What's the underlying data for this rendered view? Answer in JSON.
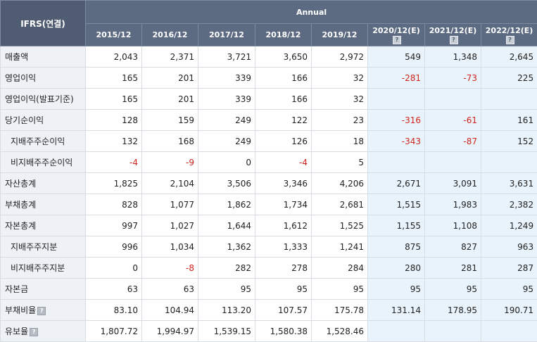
{
  "header": {
    "corner_label": "IFRS(연결)",
    "group_label": "Annual",
    "help_glyph": "?"
  },
  "columns": [
    {
      "label": "2015/12",
      "estimate": false
    },
    {
      "label": "2016/12",
      "estimate": false
    },
    {
      "label": "2017/12",
      "estimate": false
    },
    {
      "label": "2018/12",
      "estimate": false
    },
    {
      "label": "2019/12",
      "estimate": false
    },
    {
      "label": "2020/12(E)",
      "estimate": true
    },
    {
      "label": "2021/12(E)",
      "estimate": true
    },
    {
      "label": "2022/12(E)",
      "estimate": true
    }
  ],
  "rows": [
    {
      "label": "매출액",
      "sub": false,
      "help": false,
      "values": [
        "2,043",
        "2,371",
        "3,721",
        "3,650",
        "2,972",
        "549",
        "1,348",
        "2,645"
      ]
    },
    {
      "label": "영업이익",
      "sub": false,
      "help": false,
      "values": [
        "165",
        "201",
        "339",
        "166",
        "32",
        "-281",
        "-73",
        "225"
      ]
    },
    {
      "label": "영업이익(발표기준)",
      "sub": false,
      "help": false,
      "values": [
        "165",
        "201",
        "339",
        "166",
        "32",
        "",
        "",
        ""
      ]
    },
    {
      "label": "당기순이익",
      "sub": false,
      "help": false,
      "values": [
        "128",
        "159",
        "249",
        "122",
        "23",
        "-316",
        "-61",
        "161"
      ]
    },
    {
      "label": "지배주주순이익",
      "sub": true,
      "help": false,
      "values": [
        "132",
        "168",
        "249",
        "126",
        "18",
        "-343",
        "-87",
        "152"
      ]
    },
    {
      "label": "비지배주주순이익",
      "sub": true,
      "help": false,
      "values": [
        "-4",
        "-9",
        "0",
        "-4",
        "5",
        "",
        "",
        ""
      ]
    },
    {
      "label": "자산총계",
      "sub": false,
      "help": false,
      "values": [
        "1,825",
        "2,104",
        "3,506",
        "3,346",
        "4,206",
        "2,671",
        "3,091",
        "3,631"
      ]
    },
    {
      "label": "부채총계",
      "sub": false,
      "help": false,
      "values": [
        "828",
        "1,077",
        "1,862",
        "1,734",
        "2,681",
        "1,515",
        "1,983",
        "2,382"
      ]
    },
    {
      "label": "자본총계",
      "sub": false,
      "help": false,
      "values": [
        "997",
        "1,027",
        "1,644",
        "1,612",
        "1,525",
        "1,155",
        "1,108",
        "1,249"
      ]
    },
    {
      "label": "지배주주지분",
      "sub": true,
      "help": false,
      "values": [
        "996",
        "1,034",
        "1,362",
        "1,333",
        "1,241",
        "875",
        "827",
        "963"
      ]
    },
    {
      "label": "비지배주주지분",
      "sub": true,
      "help": false,
      "values": [
        "0",
        "-8",
        "282",
        "278",
        "284",
        "280",
        "281",
        "287"
      ]
    },
    {
      "label": "자본금",
      "sub": false,
      "help": false,
      "values": [
        "63",
        "63",
        "95",
        "95",
        "95",
        "95",
        "95",
        "95"
      ]
    },
    {
      "label": "부채비율",
      "sub": false,
      "help": true,
      "values": [
        "83.10",
        "104.94",
        "113.20",
        "107.57",
        "175.78",
        "131.14",
        "178.95",
        "190.71"
      ]
    },
    {
      "label": "유보율",
      "sub": false,
      "help": true,
      "values": [
        "1,807.72",
        "1,994.97",
        "1,539.15",
        "1,580.38",
        "1,528.46",
        "",
        "",
        ""
      ]
    }
  ],
  "colors": {
    "header_bg": "#5d6b82",
    "label_bg": "#eef1f6",
    "estimate_bg": "#e8f3fb",
    "negative": "#d0241c"
  }
}
